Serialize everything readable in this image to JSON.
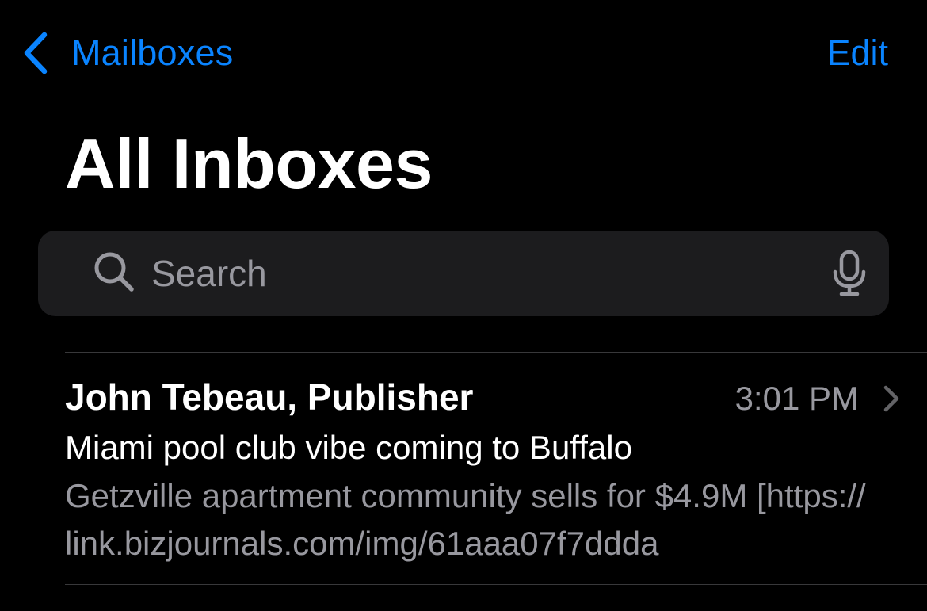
{
  "colors": {
    "background": "#000000",
    "accent": "#0a84ff",
    "primary_text": "#ffffff",
    "secondary_text": "#98989f",
    "search_field": "#1c1c1e",
    "divider": "#38383a"
  },
  "nav": {
    "back_icon": "chevron-left-icon",
    "back_label": "Mailboxes",
    "edit_label": "Edit"
  },
  "title": "All Inboxes",
  "search": {
    "icon": "search-icon",
    "placeholder": "Search",
    "value": "",
    "mic_icon": "microphone-icon"
  },
  "messages": [
    {
      "sender": "John Tebeau, Publisher",
      "time": "3:01 PM",
      "subject": "Miami pool club vibe coming to Buffalo",
      "preview": "Getzville apartment community sells for $4.9M [https://link.bizjournals.com/img/61aaa07f7ddda",
      "chevron_icon": "chevron-right-icon"
    }
  ]
}
